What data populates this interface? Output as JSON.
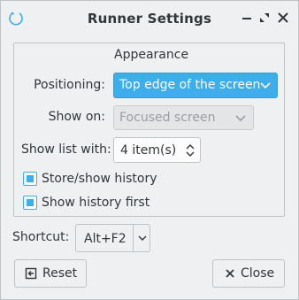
{
  "window": {
    "title": "Runner Settings",
    "app_icon": "runner-app-icon",
    "buttons": [
      "minimize-icon",
      "maximize-icon",
      "close-icon"
    ]
  },
  "appearance": {
    "title": "Appearance",
    "positioning": {
      "label": "Positioning:",
      "value": "Top edge of the screen"
    },
    "show_on": {
      "label": "Show on:",
      "value": "Focused screen",
      "enabled": false
    },
    "show_list_with": {
      "label": "Show list with:",
      "value": "4 item(s)"
    },
    "store_history": {
      "label": "Store/show history",
      "checked": true
    },
    "history_first": {
      "label": "Show history first",
      "checked": true
    }
  },
  "shortcut": {
    "label": "Shortcut:",
    "value": "Alt+F2"
  },
  "buttons": {
    "reset": "Reset",
    "close": "Close"
  },
  "colors": {
    "accent": "#3daee9",
    "background": "#eff0f1",
    "text": "#31363b",
    "border": "#bdc3c7"
  }
}
